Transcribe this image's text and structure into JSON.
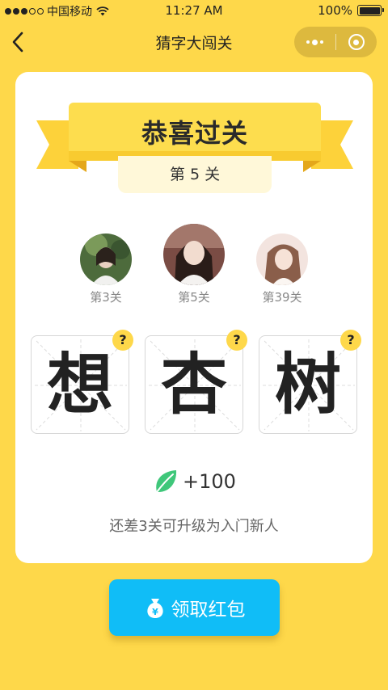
{
  "status_bar": {
    "carrier": "中国移动",
    "time": "11:27 AM",
    "battery": "100%",
    "signal_bars_filled": 3,
    "signal_bars_total": 5
  },
  "nav": {
    "title": "猜字大闯关",
    "back_icon": "chevron-left-icon",
    "more_icon": "more-dots-icon",
    "close_icon": "target-close-icon"
  },
  "card": {
    "banner_title": "恭喜过关",
    "level_text": "第 5 关",
    "players": [
      {
        "label": "第3关"
      },
      {
        "label": "第5关"
      },
      {
        "label": "第39关"
      }
    ],
    "characters": [
      {
        "char": "想",
        "help": "?"
      },
      {
        "char": "杏",
        "help": "?"
      },
      {
        "char": "树",
        "help": "?"
      }
    ],
    "reward": {
      "icon": "leaf-icon",
      "value": "+100"
    },
    "hint": "还差3关可升级为入门新人"
  },
  "claim_button": {
    "label": "领取红包",
    "icon": "money-bag-icon"
  },
  "colors": {
    "background": "#fed84a",
    "ribbon": "#fdd23a",
    "ribbon_dark": "#f0b822",
    "button": "#10bdf7",
    "leaf": "#3fc77a"
  }
}
